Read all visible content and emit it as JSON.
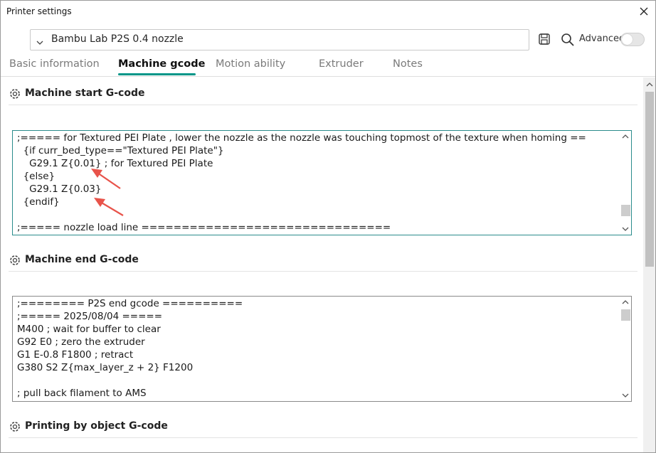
{
  "window": {
    "title": "Printer settings"
  },
  "preset": {
    "value": "Bambu Lab P2S 0.4 nozzle"
  },
  "header": {
    "advanced_label": "Advanced"
  },
  "tabs": [
    {
      "label": "Basic information"
    },
    {
      "label": "Machine gcode"
    },
    {
      "label": "Motion ability"
    },
    {
      "label": "Extruder"
    },
    {
      "label": "Notes"
    }
  ],
  "sections": {
    "start": {
      "title": "Machine start G-code",
      "lines": [
        ";===== for Textured PEI Plate , lower the nozzle as the nozzle was touching topmost of the texture when homing ==",
        "  {if curr_bed_type==\"Textured PEI Plate\"}",
        "    G29.1 Z{0.01} ; for Textured PEI Plate",
        "  {else}",
        "    G29.1 Z{0.03}",
        "  {endif}",
        "",
        ";===== nozzle load line ==============================="
      ]
    },
    "end": {
      "title": "Machine end G-code",
      "lines": [
        ";======== P2S end gcode ==========",
        ";===== 2025/08/04 =====",
        "M400 ; wait for buffer to clear",
        "G92 E0 ; zero the extruder",
        "G1 E-0.8 F1800 ; retract",
        "G380 S2 Z{max_layer_z + 2} F1200",
        "",
        "; pull back filament to AMS"
      ]
    },
    "by_object": {
      "title": "Printing by object G-code"
    }
  },
  "colors": {
    "accent": "#009688",
    "annotation_arrow": "#e8534a"
  }
}
